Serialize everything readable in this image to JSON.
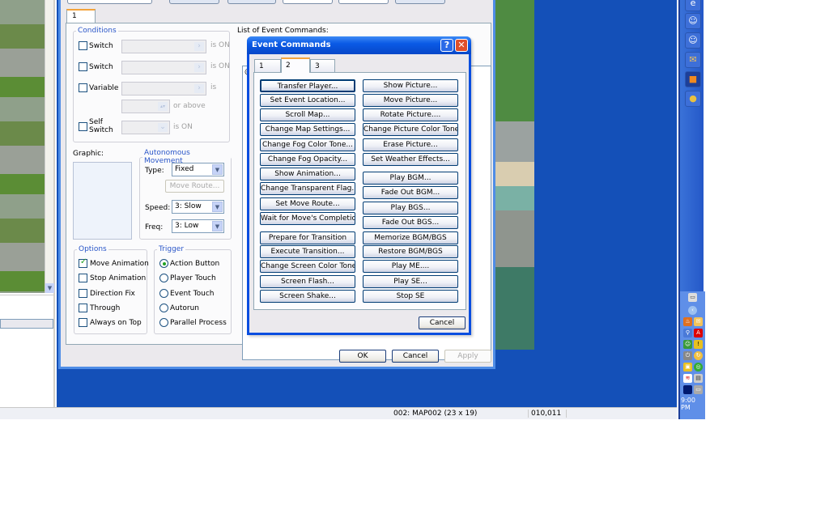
{
  "event_window": {
    "tab": "1",
    "conditions": {
      "legend": "Conditions",
      "switch1": "Switch",
      "switch2": "Switch",
      "variable": "Variable",
      "self_switch": "Self Switch",
      "is_on": "is ON",
      "is": "is",
      "or_above": "or above"
    },
    "graphic_label": "Graphic:",
    "autonomous": {
      "legend": "Autonomous Movement",
      "type_label": "Type:",
      "type_value": "Fixed",
      "move_route": "Move Route...",
      "speed_label": "Speed:",
      "speed_value": "3: Slow",
      "freq_label": "Freq:",
      "freq_value": "3: Low"
    },
    "options": {
      "legend": "Options",
      "items": [
        {
          "label": "Move Animation",
          "checked": true
        },
        {
          "label": "Stop Animation",
          "checked": false
        },
        {
          "label": "Direction Fix",
          "checked": false
        },
        {
          "label": "Through",
          "checked": false
        },
        {
          "label": "Always on Top",
          "checked": false
        }
      ]
    },
    "trigger": {
      "legend": "Trigger",
      "items": [
        {
          "label": "Action Button",
          "selected": true
        },
        {
          "label": "Player Touch",
          "selected": false
        },
        {
          "label": "Event Touch",
          "selected": false
        },
        {
          "label": "Autorun",
          "selected": false
        },
        {
          "label": "Parallel Process",
          "selected": false
        }
      ]
    },
    "list_label": "List of Event Commands:",
    "list_first": "@>",
    "ok": "OK",
    "cancel": "Cancel",
    "apply": "Apply"
  },
  "event_commands": {
    "title": "Event Commands",
    "help": "?",
    "close": "✕",
    "tabs": [
      "1",
      "2",
      "3"
    ],
    "active_tab": "2",
    "left": [
      "Transfer Player...",
      "Set Event Location...",
      "Scroll Map...",
      "Change Map Settings...",
      "Change Fog Color Tone...",
      "Change Fog Opacity...",
      "Show Animation...",
      "Change Transparent Flag...",
      "Set Move Route...",
      "Wait for Move's Completion",
      "Prepare for Transition",
      "Execute Transition...",
      "Change Screen Color Tone...",
      "Screen Flash...",
      "Screen Shake..."
    ],
    "right": [
      "Show Picture...",
      "Move Picture...",
      "Rotate Picture....",
      "Change Picture Color Tone...",
      "Erase Picture...",
      "Set Weather Effects...",
      "Play BGM...",
      "Fade Out BGM...",
      "Play BGS...",
      "Fade Out BGS...",
      "Memorize BGM/BGS",
      "Restore BGM/BGS",
      "Play ME....",
      "Play SE...",
      "Stop SE"
    ],
    "cancel": "Cancel"
  },
  "status": {
    "map": "002: MAP002 (23 x 19)",
    "coords": "010,011"
  },
  "taskbar": {
    "clock": "9:00 PM"
  },
  "colors": {
    "desktop_blue": "#1450b8",
    "title_blue": "#0a5ae6",
    "tab_accent": "#f4a43c"
  }
}
